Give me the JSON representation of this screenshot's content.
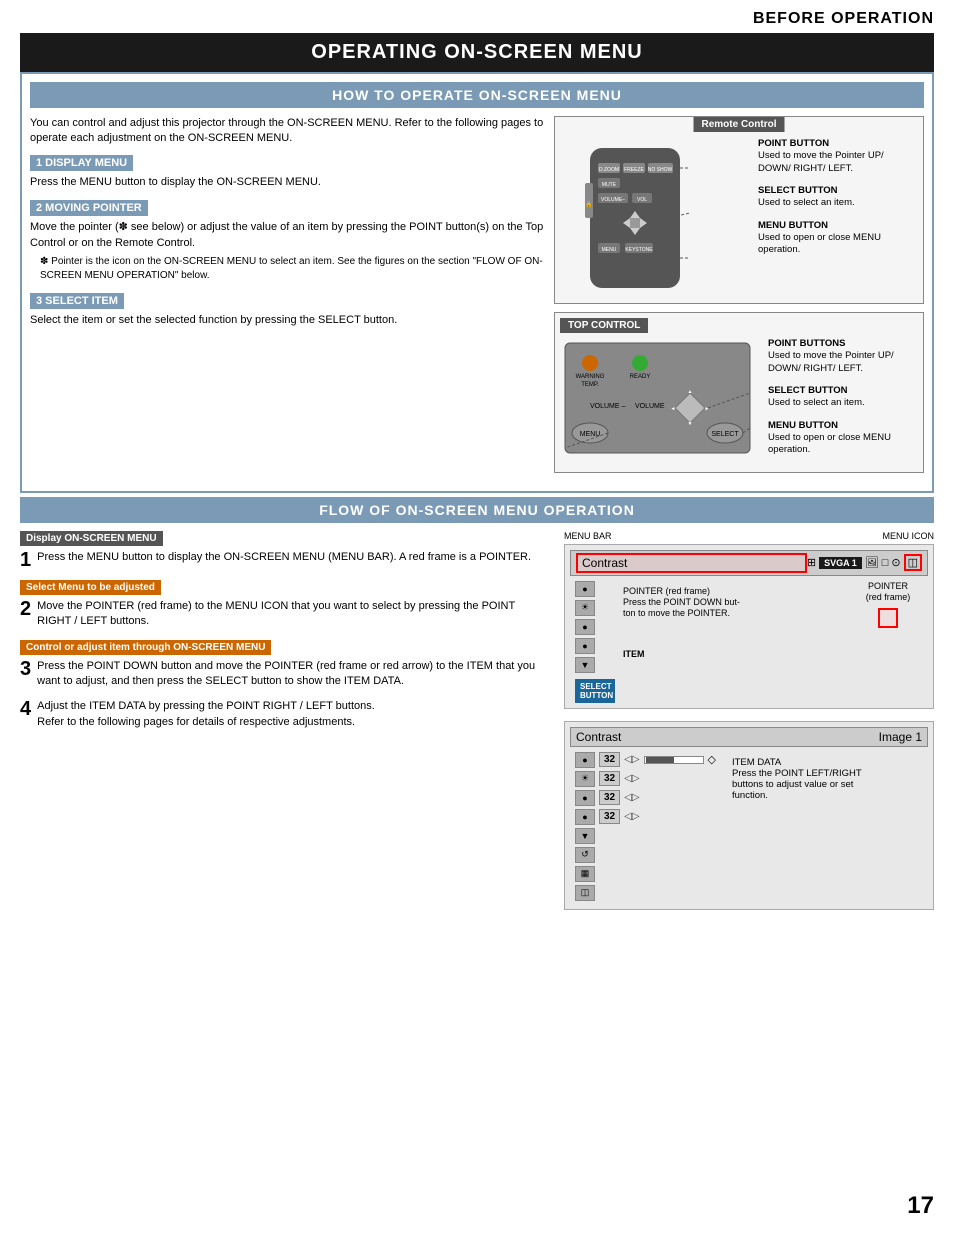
{
  "header": {
    "title": "BEFORE OPERATION"
  },
  "page_number": "17",
  "main_title": "OPERATING ON-SCREEN MENU",
  "section1": {
    "title": "HOW TO OPERATE ON-SCREEN MENU",
    "intro": "You can control and adjust this projector through the ON-SCREEN MENU.  Refer to the following pages to operate each adjustment on the ON-SCREEN MENU.",
    "step1_label": "1  DISPLAY MENU",
    "step1_text": "Press the MENU button to display the ON-SCREEN MENU.",
    "step2_label": "2  MOVING POINTER",
    "step2_text": "Move the pointer (✽ see below) or adjust the value of an item by pressing the POINT button(s) on the Top Control or on the Remote Control.",
    "step2_note": "✽  Pointer is the icon on the ON-SCREEN MENU to select an item. See the figures on the section \"FLOW OF ON-SCREEN MENU OPERATION\" below.",
    "step3_label": "3  SELECT ITEM",
    "step3_text": "Select the item or set the selected function by pressing the SELECT button."
  },
  "remote_control": {
    "title": "Remote Control",
    "point_button_label": "POINT BUTTON",
    "point_button_desc": "Used to move the Pointer UP/ DOWN/ RIGHT/ LEFT.",
    "select_button_label": "SELECT BUTTON",
    "select_button_desc": "Used to select an item.",
    "menu_button_label": "MENU BUTTON",
    "menu_button_desc": "Used to open or close MENU operation.",
    "buttons": [
      "D.ZOOM",
      "FREEZE",
      "NO SHOW",
      "MUTE",
      "VOLUME–",
      "VOL",
      "MENU",
      "KEYSTONE"
    ]
  },
  "top_control": {
    "title": "TOP CONTROL",
    "point_buttons_label": "POINT BUTTONS",
    "point_buttons_desc": "Used to move the Pointer UP/ DOWN/ RIGHT/ LEFT.",
    "select_button_label": "SELECT BUTTON",
    "select_button_desc": "Used to select an item.",
    "menu_button_label": "MENU BUTTON",
    "menu_button_desc": "Used to open or close MENU operation.",
    "labels": [
      "WARNING TEMP.",
      "READY",
      "VOLUME –",
      "VOLUME",
      "MENU",
      "SELECT"
    ]
  },
  "section2": {
    "title": "FLOW OF ON-SCREEN MENU OPERATION",
    "display_label": "Display ON-SCREEN MENU",
    "step1_num": "1",
    "step1_text": "Press the MENU button to display the ON-SCREEN MENU (MENU BAR).  A red frame is a POINTER.",
    "select_label": "Select Menu to be adjusted",
    "step2_num": "2",
    "step2_text": "Move the POINTER (red frame) to the MENU ICON that you want to select by pressing the POINT RIGHT / LEFT buttons.",
    "control_label": "Control or adjust item through ON-SCREEN MENU",
    "step3_num": "3",
    "step3_text": "Press the POINT DOWN button and move the POINTER (red frame or red arrow) to the ITEM that you want to adjust, and then press the SELECT button to show the ITEM DATA.",
    "step4_num": "4",
    "step4_text": "Adjust the ITEM DATA by pressing the POINT RIGHT / LEFT buttons.\nRefer to the following pages for details of respective adjustments.",
    "menu_bar_label": "MENU BAR",
    "menu_icon_label": "MENU ICON",
    "pointer_label": "POINTER\n(red frame)",
    "pointer_frame_label": "POINTER (red frame)\nPress the POINT DOWN but-\nton to move the POINTER.",
    "item_label": "ITEM",
    "select_button_box": "SELECT\nBUTTON",
    "menu_contrast": "Contrast",
    "menu_svga": "SVGA 1",
    "menu_image": "Image 1",
    "item_data_label": "ITEM DATA\nPress the POINT LEFT/RIGHT\nbuttons to adjust value or set\nfunction.",
    "item_values": [
      "32",
      "32",
      "32",
      "32"
    ],
    "item_icons": [
      "●",
      "☀",
      "●",
      "●",
      "▼",
      "↺",
      "▦",
      "◫"
    ]
  }
}
